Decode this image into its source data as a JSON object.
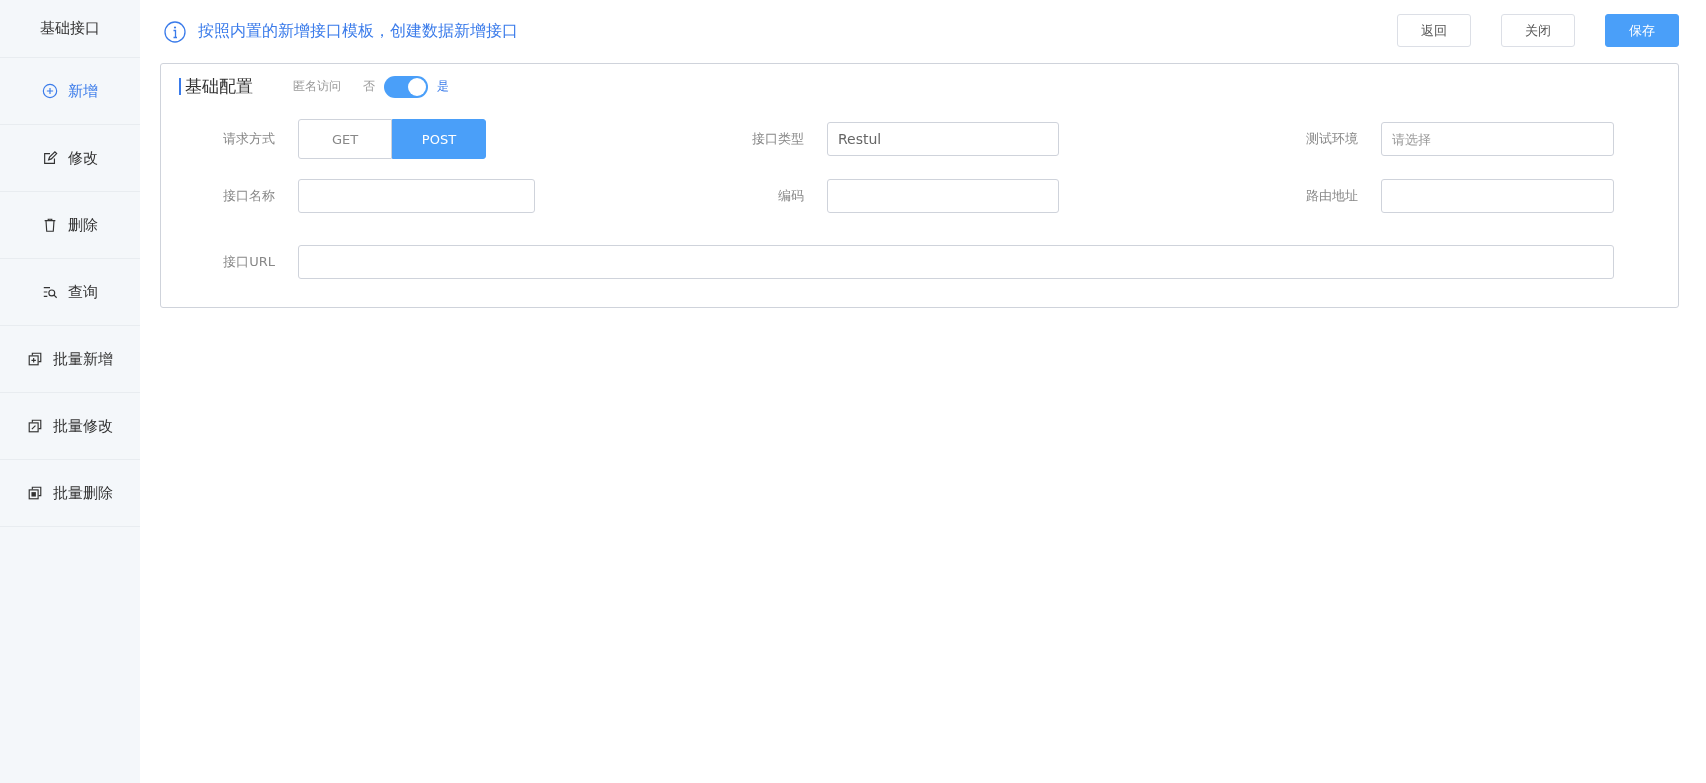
{
  "sidebar": {
    "title": "基础接口",
    "items": [
      {
        "label": "新增",
        "kind": "add",
        "selected": true
      },
      {
        "label": "修改",
        "kind": "edit",
        "selected": false
      },
      {
        "label": "删除",
        "kind": "delete",
        "selected": false
      },
      {
        "label": "查询",
        "kind": "query",
        "selected": false
      },
      {
        "label": "批量新增",
        "kind": "batch-add",
        "selected": false
      },
      {
        "label": "批量修改",
        "kind": "batch-edit",
        "selected": false
      },
      {
        "label": "批量删除",
        "kind": "batch-delete",
        "selected": false
      }
    ]
  },
  "notice": "按照内置的新增接口模板，创建数据新增接口",
  "buttons": [
    {
      "label": "返回",
      "primary": false
    },
    {
      "label": "关闭",
      "primary": false
    },
    {
      "label": "保存",
      "primary": true
    }
  ],
  "section": {
    "title": "基础配置",
    "anonymous": {
      "label": "匿名访问",
      "off_label": "否",
      "on_label": "是",
      "on": true
    },
    "fields": [
      {
        "label": "请求方式",
        "kind": "segmented",
        "options": [
          {
            "label": "GET",
            "selected": false
          },
          {
            "label": "POST",
            "selected": true
          }
        ]
      },
      {
        "label": "接口类型",
        "kind": "input",
        "value": "Restul"
      },
      {
        "label": "测试环境",
        "kind": "input",
        "placeholder": "请选择"
      },
      {
        "label": "接口名称",
        "kind": "input"
      },
      {
        "label": "编码",
        "kind": "input"
      },
      {
        "label": "路由地址",
        "kind": "input"
      },
      {
        "label": "接口URL",
        "kind": "input",
        "wide": true
      }
    ]
  }
}
